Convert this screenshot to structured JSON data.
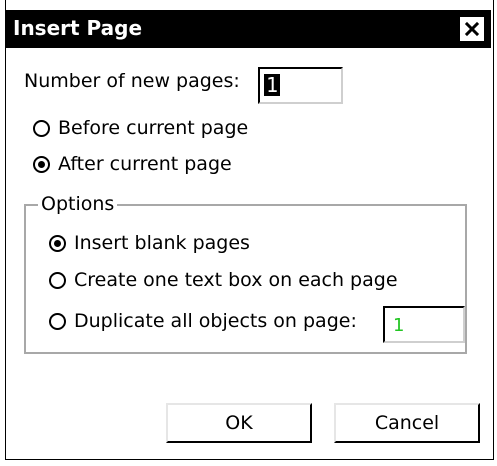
{
  "window": {
    "title": "Insert Page",
    "close_glyph": "✕"
  },
  "pages": {
    "label": "Number of new pages:",
    "value": "1"
  },
  "placement": {
    "before_label": "Before current page",
    "after_label": "After current page",
    "selected": "after"
  },
  "options": {
    "legend": "Options",
    "insert_blank_label": "Insert blank pages",
    "text_box_label": "Create one text box on each page",
    "duplicate_label": "Duplicate all objects on page:",
    "duplicate_value": "1",
    "duplicate_value_color": "#22c522",
    "selected": "insert_blank"
  },
  "buttons": {
    "ok_label": "OK",
    "cancel_label": "Cancel"
  }
}
